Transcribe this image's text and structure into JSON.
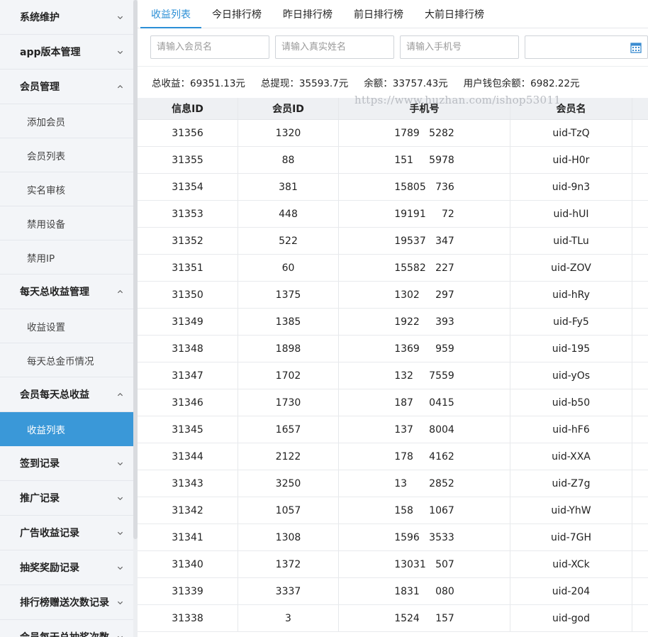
{
  "sidebar": {
    "items": [
      {
        "label": "系统维护",
        "type": "group",
        "chevron": "chevron-down-icon"
      },
      {
        "label": "app版本管理",
        "type": "group",
        "chevron": "chevron-down-icon"
      },
      {
        "label": "会员管理",
        "type": "group",
        "chevron": "chevron-up-icon"
      },
      {
        "label": "添加会员",
        "type": "child"
      },
      {
        "label": "会员列表",
        "type": "child"
      },
      {
        "label": "实名审核",
        "type": "child"
      },
      {
        "label": "禁用设备",
        "type": "child"
      },
      {
        "label": "禁用IP",
        "type": "child"
      },
      {
        "label": "每天总收益管理",
        "type": "group",
        "chevron": "chevron-up-icon"
      },
      {
        "label": "收益设置",
        "type": "child"
      },
      {
        "label": "每天总金币情况",
        "type": "child"
      },
      {
        "label": "会员每天总收益",
        "type": "group",
        "chevron": "chevron-up-icon"
      },
      {
        "label": "收益列表",
        "type": "child",
        "active": true
      },
      {
        "label": "签到记录",
        "type": "group",
        "chevron": "chevron-down-icon"
      },
      {
        "label": "推广记录",
        "type": "group",
        "chevron": "chevron-down-icon"
      },
      {
        "label": "广告收益记录",
        "type": "group",
        "chevron": "chevron-down-icon"
      },
      {
        "label": "抽奖奖励记录",
        "type": "group",
        "chevron": "chevron-down-icon"
      },
      {
        "label": "排行榜赠送次数记录",
        "type": "group",
        "chevron": "chevron-down-icon"
      },
      {
        "label": "会员每天总抽奖次数",
        "type": "group",
        "chevron": "chevron-down-icon"
      }
    ]
  },
  "tabs": [
    "收益列表",
    "今日排行榜",
    "昨日排行榜",
    "前日排行榜",
    "大前日排行榜"
  ],
  "filters": {
    "member_name_placeholder": "请输入会员名",
    "real_name_placeholder": "请输入真实姓名",
    "phone_placeholder": "请输入手机号"
  },
  "summary": {
    "total_income": "总收益：69351.13元",
    "total_withdraw": "总提现：35593.7元",
    "balance": "余额：33757.43元",
    "wallet_balance": "用户钱包余额：6982.22元"
  },
  "watermark": "https://www.huzhan.com/ishop53011",
  "table": {
    "headers": [
      "信息ID",
      "会员ID",
      "手机号",
      "会员名"
    ],
    "rows": [
      [
        "31356",
        "1320",
        "1789   5282",
        "uid-TzQ"
      ],
      [
        "31355",
        "88",
        "151     5978",
        "uid-H0r"
      ],
      [
        "31354",
        "381",
        "15805   736",
        "uid-9n3"
      ],
      [
        "31353",
        "448",
        "19191     72",
        "uid-hUI"
      ],
      [
        "31352",
        "522",
        "19537   347",
        "uid-TLu"
      ],
      [
        "31351",
        "60",
        "15582   227",
        "uid-ZOV"
      ],
      [
        "31350",
        "1375",
        "1302     297",
        "uid-hRy"
      ],
      [
        "31349",
        "1385",
        "1922     393",
        "uid-Fy5"
      ],
      [
        "31348",
        "1898",
        "1369     959",
        "uid-195"
      ],
      [
        "31347",
        "1702",
        "132     7559",
        "uid-yOs"
      ],
      [
        "31346",
        "1730",
        "187     0415",
        "uid-b50"
      ],
      [
        "31345",
        "1657",
        "137     8004",
        "uid-hF6"
      ],
      [
        "31344",
        "2122",
        "178     4162",
        "uid-XXA"
      ],
      [
        "31343",
        "3250",
        "13       2852",
        "uid-Z7g"
      ],
      [
        "31342",
        "1057",
        "158     1067",
        "uid-YhW"
      ],
      [
        "31341",
        "1308",
        "1596   3533",
        "uid-7GH"
      ],
      [
        "31340",
        "1372",
        "13031   507",
        "uid-XCk"
      ],
      [
        "31339",
        "3337",
        "1831     080",
        "uid-204"
      ],
      [
        "31338",
        "3",
        "1524     157",
        "uid-god"
      ]
    ]
  }
}
